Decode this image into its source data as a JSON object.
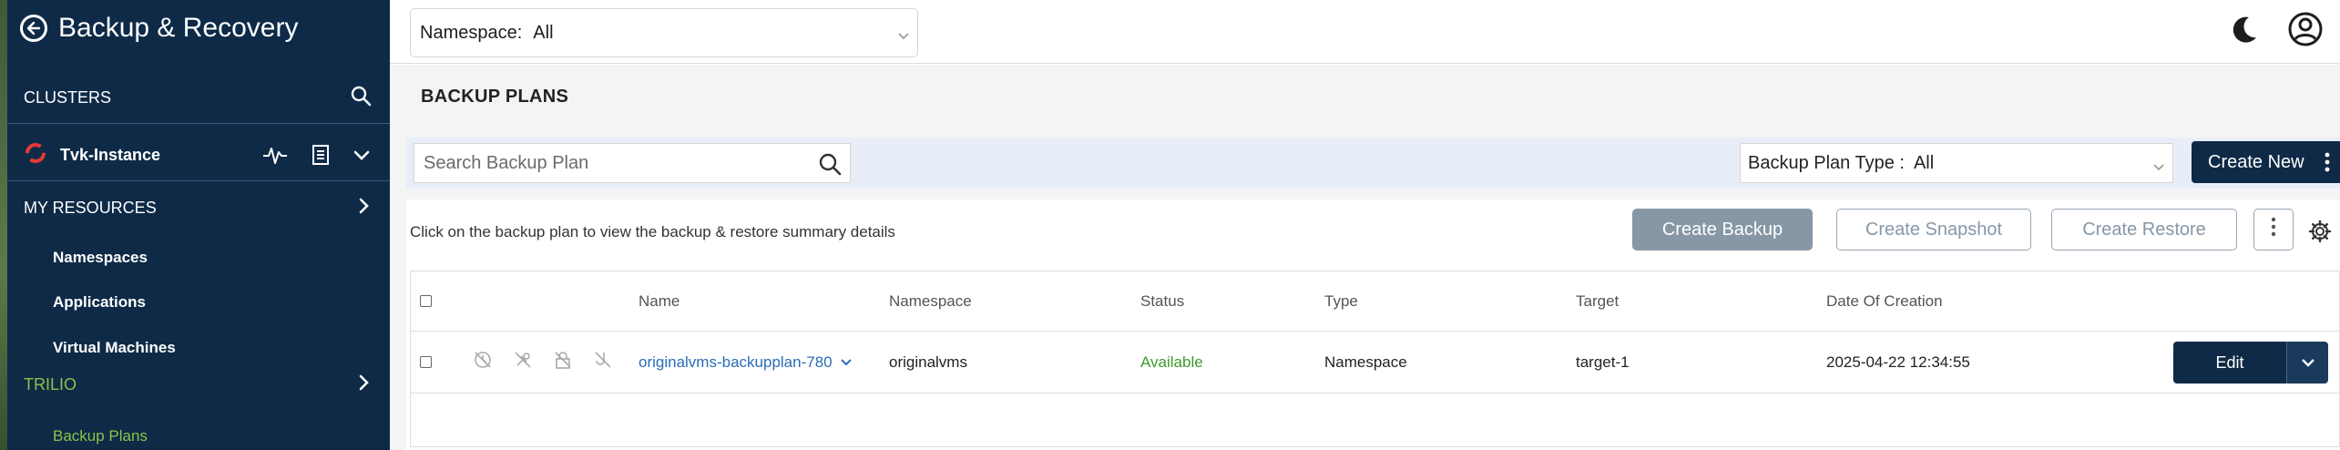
{
  "sidebar": {
    "title": "Backup & Recovery",
    "clusters_label": "CLUSTERS",
    "instance_name": "Tvk-Instance",
    "my_resources_label": "MY RESOURCES",
    "resources": [
      "Namespaces",
      "Applications",
      "Virtual Machines"
    ],
    "trilio_label": "TRILIO",
    "trilio_items": [
      "Backup Plans"
    ]
  },
  "topbar": {
    "namespace_label": "Namespace:",
    "namespace_value": "All"
  },
  "main": {
    "title": "BACKUP PLANS",
    "search_placeholder": "Search Backup Plan",
    "type_label": "Backup Plan Type :",
    "type_value": "All",
    "create_new_label": "Create New",
    "hint": "Click on the backup plan to view the backup & restore summary details",
    "create_backup_label": "Create Backup",
    "create_snapshot_label": "Create Snapshot",
    "create_restore_label": "Create Restore"
  },
  "table": {
    "columns": [
      "Name",
      "Namespace",
      "Status",
      "Type",
      "Target",
      "Date Of Creation"
    ],
    "rows": [
      {
        "name": "originalvms-backupplan-780",
        "namespace": "originalvms",
        "status": "Available",
        "type": "Namespace",
        "target": "target-1",
        "date": "2025-04-22 12:34:55",
        "action": "Edit"
      }
    ]
  },
  "colors": {
    "sidebar_bg": "#0e2a47",
    "accent_green": "#8bc34a",
    "link_blue": "#2a6db4",
    "status_green": "#3d9a2c",
    "disabled_button": "#8797a6"
  }
}
